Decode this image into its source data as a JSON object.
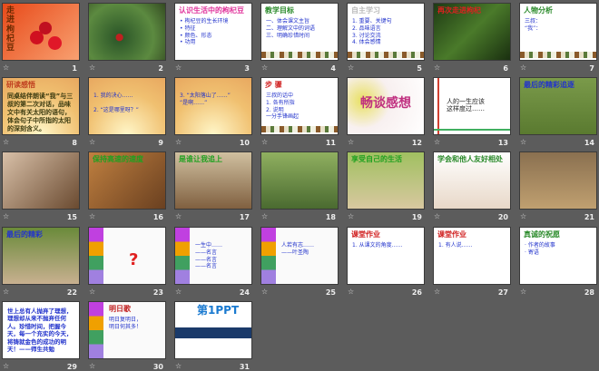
{
  "slides": [
    {
      "n": "1",
      "title": "走进枸杞豆",
      "body": "",
      "bg": "linear-gradient(135deg,#e84a1a,#f8a070)",
      "tc": "#6a2a00",
      "kind": "berries"
    },
    {
      "n": "2",
      "title": "",
      "body": "",
      "bg": "radial-gradient(circle at 40% 60%,#c02020 0 6%,#2f5a2a 7%,#5c8a40 60%,#344a22)",
      "tc": "#fff",
      "kind": "photo"
    },
    {
      "n": "3",
      "title": "认识生活中的枸杞豆",
      "body": "• 枸杞豆的生长环境\n• 特征\n• 颜色、形态\n• 功用",
      "bg": "#ffffff",
      "tc": "#e0309a",
      "kind": "text"
    },
    {
      "n": "4",
      "title": "教学目标",
      "body": "一、体会课文主旨\n二、理解文中的词语\n三、明确珍惜时间",
      "bg": "#ffffff",
      "tc": "#2a8a2a",
      "kind": "deco"
    },
    {
      "n": "5",
      "title": "自主学习",
      "body": "1. 重要、关键句\n2. 品味语言\n3. 讨论交流\n4. 体会感情",
      "bg": "#ffffff",
      "tc": "#bbbbbb",
      "kind": "deco"
    },
    {
      "n": "6",
      "title": "再次走进枸杞",
      "body": "",
      "bg": "linear-gradient(135deg,#1e3a14,#4a7a2a 50%,#1a3010)",
      "tc": "#e02020",
      "kind": "photo"
    },
    {
      "n": "7",
      "title": "人物分析",
      "body": "三叔：\n“我”：",
      "bg": "#ffffff",
      "tc": "#2a8a2a",
      "kind": "deco"
    },
    {
      "n": "8",
      "title": "研读感悟",
      "body": "同桌结伴朗读“我”与三叔的第二次对话，品味文中有关太阳的语句，体会句子中所指的太阳的深刻含义。",
      "bg": "radial-gradient(circle at 50% 100%,#fff6c8,#f0c070 60%,#e8a860)",
      "tc": "#c04020",
      "kind": "sun"
    },
    {
      "n": "9",
      "title": "",
      "body": "1. 我的决心……\n\n2. “这是哪里呀？”",
      "bg": "radial-gradient(circle at 50% 100%,#fff6c8,#f0c070 60%,#e8a860)",
      "tc": "#2233cc",
      "kind": "sun"
    },
    {
      "n": "10",
      "title": "",
      "body": "3. “太阳落山了……”\n“是啊……”",
      "bg": "radial-gradient(circle at 50% 100%,#fff6c8,#f0c070 60%,#e8a860)",
      "tc": "#2233cc",
      "kind": "sun"
    },
    {
      "n": "11",
      "title": "步 骤",
      "body": "三叔的话中\n1. 各有所指\n2. 说明\n一分手锋画起",
      "bg": "#ffffff",
      "tc": "#d02020",
      "kind": "deco"
    },
    {
      "n": "12",
      "title": "畅谈感想",
      "body": "",
      "bg": "radial-gradient(circle at 20% 40%,#e8e060,#f8f0f0 40%,#ffffff)",
      "tc": "#c03080",
      "kind": "big"
    },
    {
      "n": "13",
      "title": "人的一生应该\n这样度过……",
      "body": "",
      "bg": "#ffffff",
      "tc": "#222",
      "kind": "lines"
    },
    {
      "n": "14",
      "title": "最后的精彩追逐",
      "body": "",
      "bg": "linear-gradient(#7a9a4a,#5a7a30)",
      "tc": "#2233cc",
      "kind": "photo"
    },
    {
      "n": "15",
      "title": "",
      "body": "",
      "bg": "linear-gradient(135deg,#d8c0a8,#6a4a30)",
      "tc": "#fff",
      "kind": "photo"
    },
    {
      "n": "16",
      "title": "保持高速的速度",
      "body": "",
      "bg": "linear-gradient(135deg,#c08040,#6a4020)",
      "tc": "#20a020",
      "kind": "photo"
    },
    {
      "n": "17",
      "title": "是谁让我追上",
      "body": "",
      "bg": "linear-gradient(#d0c0a0,#806040)",
      "tc": "#20a020",
      "kind": "photo"
    },
    {
      "n": "18",
      "title": "",
      "body": "",
      "bg": "linear-gradient(#90b060,#4a6a30)",
      "tc": "#fff",
      "kind": "photo"
    },
    {
      "n": "19",
      "title": "享受自己的生活",
      "body": "",
      "bg": "linear-gradient(#a0c060,#d8c8a0)",
      "tc": "#20a020",
      "kind": "photo"
    },
    {
      "n": "20",
      "title": "学会和他人友好相处",
      "body": "",
      "bg": "linear-gradient(#ffffff,#e8d8c8)",
      "tc": "#2a8a2a",
      "kind": "photo"
    },
    {
      "n": "21",
      "title": "",
      "body": "",
      "bg": "linear-gradient(#8a7050,#c0a070)",
      "tc": "#fff",
      "kind": "photo"
    },
    {
      "n": "22",
      "title": "最后的精彩",
      "body": "",
      "bg": "linear-gradient(#6a8a3a,#c8b090)",
      "tc": "#2233cc",
      "kind": "photo"
    },
    {
      "n": "23",
      "title": "?",
      "body": "",
      "bg": "#fafafa",
      "tc": "#e02020",
      "kind": "side"
    },
    {
      "n": "24",
      "title": "",
      "body": "一生中……\n——名言\n——名言\n——名言",
      "bg": "#fafafa",
      "tc": "#2233cc",
      "kind": "side"
    },
    {
      "n": "25",
      "title": "",
      "body": "人若有志……\n——叶圣陶",
      "bg": "#fafafa",
      "tc": "#2233cc",
      "kind": "side"
    },
    {
      "n": "26",
      "title": "课堂作业",
      "body": "1. 从课文的角度……",
      "bg": "#ffffff",
      "tc": "#d02020",
      "kind": "text"
    },
    {
      "n": "27",
      "title": "课堂作业",
      "body": "1. 有人说……",
      "bg": "#ffffff",
      "tc": "#d02020",
      "kind": "text"
    },
    {
      "n": "28",
      "title": "真诚的祝愿",
      "body": "· 作者的故事\n· 寄语",
      "bg": "#ffffff",
      "tc": "#2a8a2a",
      "kind": "text"
    },
    {
      "n": "29",
      "title": "",
      "body": "世上总有人抛弃了理想，理想却从来不抛弃任何人。珍惜时间，把握今天，每一个充实的今天，将铸就金色的成功的明天！——师生共勉",
      "bg": "#ffffff",
      "tc": "#2233cc",
      "kind": "text"
    },
    {
      "n": "30",
      "title": "明日歌",
      "body": "明日复明日，\n明日何其多！",
      "bg": "#fafafa",
      "tc": "#c02020",
      "kind": "side"
    },
    {
      "n": "31",
      "title": "第1PPT",
      "body": "",
      "bg": "#ffffff",
      "tc": "#1a7ad0",
      "kind": "ppt"
    }
  ],
  "star_icon": "☆"
}
